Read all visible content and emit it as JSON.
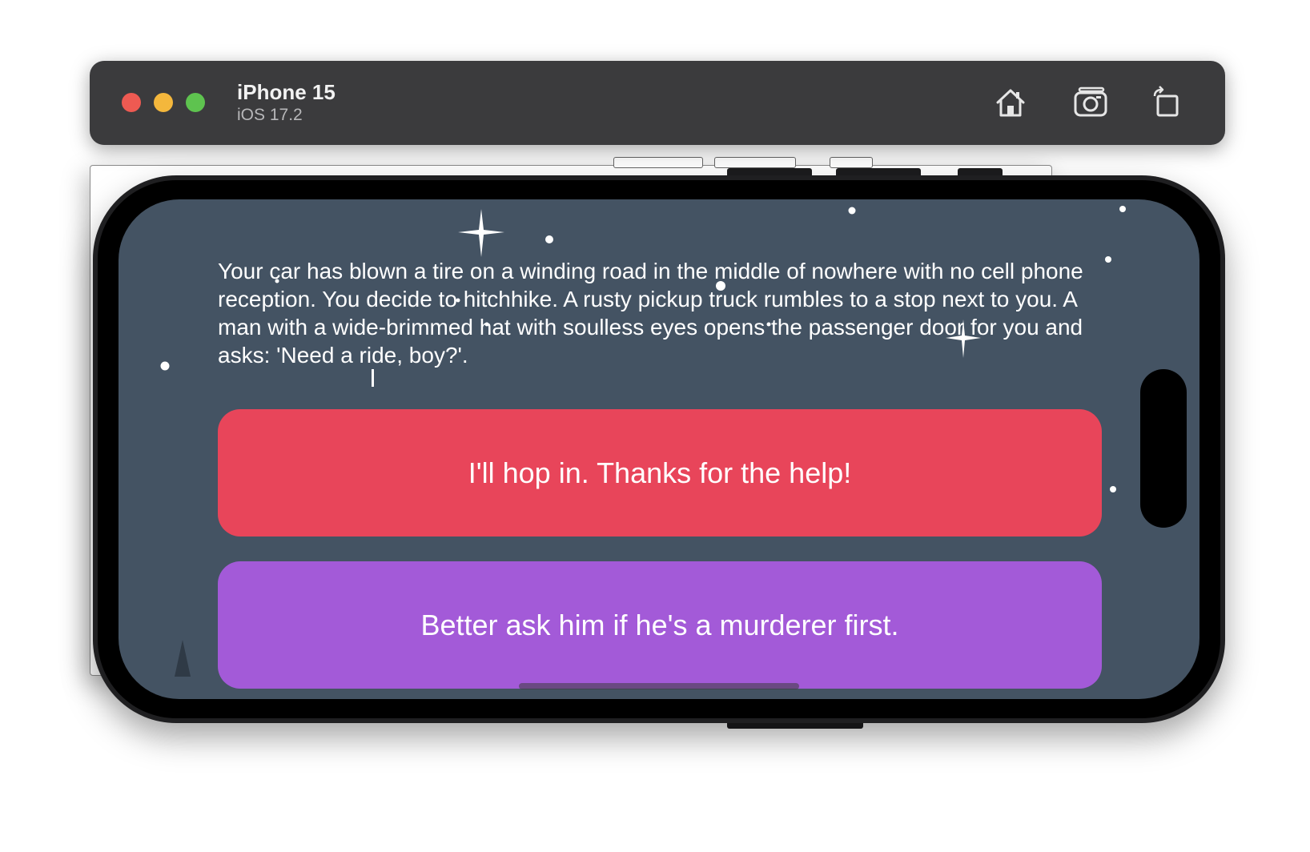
{
  "simulator": {
    "device_name": "iPhone 15",
    "os_version": "iOS 17.2",
    "toolbar": [
      {
        "icon": "home-icon"
      },
      {
        "icon": "screenshot-camera-icon"
      },
      {
        "icon": "rotate-icon"
      }
    ]
  },
  "app": {
    "story_text": "Your car has blown a tire on a winding road in the middle of nowhere with no cell phone reception. You decide to hitchhike. A rusty pickup truck rumbles to a stop next to you. A man with a wide-brimmed hat with soulless eyes opens the passenger door for you and asks: 'Need a ride, boy?'.",
    "choices": [
      {
        "label": "I'll hop in. Thanks for the help!",
        "color": "#e8455a"
      },
      {
        "label": "Better ask him if he's a murderer first.",
        "color": "#a35ad8"
      }
    ],
    "background_color": "#445363"
  },
  "colors": {
    "close": "#ee5a52",
    "minimize": "#f4b73c",
    "zoom": "#5ec34f",
    "titlebar": "#3b3b3d"
  }
}
